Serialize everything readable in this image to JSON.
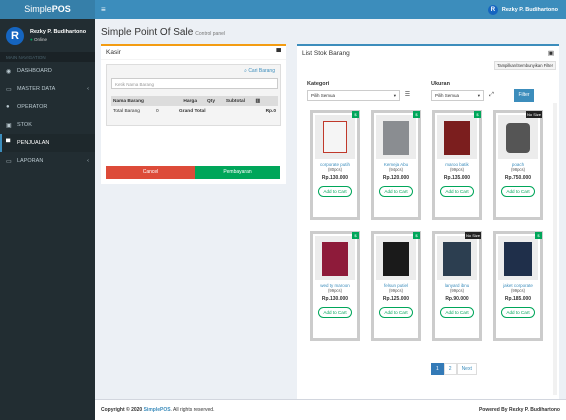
{
  "app": {
    "brand_light": "Simple",
    "brand_bold": "POS"
  },
  "topbar": {
    "menu_icon": "hamburger-icon",
    "user_name": "Rezky P. Budihartono",
    "user_initial": "R"
  },
  "sidebar": {
    "user_name": "Rezky P. Budihartono",
    "user_status": "Online",
    "user_initial": "R",
    "header": "MAIN NAVIGATION",
    "items": [
      {
        "label": "DASHBOARD",
        "icon": "dashboard-icon"
      },
      {
        "label": "MASTER DATA",
        "icon": "folder-icon",
        "chevron": "‹"
      },
      {
        "label": "OPERATOR",
        "icon": "user-icon"
      },
      {
        "label": "STOK",
        "icon": "cubes-icon"
      },
      {
        "label": "PENJUALAN",
        "icon": "cart-icon"
      },
      {
        "label": "LAPORAN",
        "icon": "folder-icon",
        "chevron": "‹"
      }
    ]
  },
  "page": {
    "title": "Simple Point Of Sale",
    "subtitle": "Control panel"
  },
  "kasir": {
    "title": "Kasir",
    "cari_link": "Cari Barang",
    "search_placeholder": "Ketik Nama Barang",
    "table_headers": [
      "Nama Barang",
      "Harga",
      "Qty",
      "Subtotal",
      ""
    ],
    "total_barang_label": "Total Barang",
    "total_barang_value": "0",
    "grand_total_label": "Grand Total",
    "grand_total_value": "Rp.0",
    "cancel_label": "Cancel",
    "pay_label": "Pembayaran"
  },
  "stok": {
    "title": "List Stok Barang",
    "filter_toggle_label": "Tampilkan/Sembunyikan Filter",
    "kategori_label": "Kategori",
    "kategori_value": "Pilih Semua",
    "ukuran_label": "Ukuran",
    "ukuran_value": "Pilih Semua",
    "filter_button": "Filter",
    "add_to_cart_label": "Add to Cart",
    "products": [
      {
        "name": "corporate putih",
        "stock": "(80pcs)",
        "price": "Rp.130.000",
        "badge": "$",
        "color": "#c0392b"
      },
      {
        "name": "Kemeja Abu",
        "stock": "(94pcs)",
        "price": "Rp.120.000",
        "badge": "$",
        "color": "#7f8c8d"
      },
      {
        "name": "maroo batik",
        "stock": "(99pcs)",
        "price": "Rp.135.000",
        "badge": "$",
        "color": "#7b1e1e"
      },
      {
        "name": "poach",
        "stock": "(98pcs)",
        "price": "Rp.750.000",
        "badge": "No Size",
        "color": "#555555"
      },
      {
        "name": "wed ty maroon",
        "stock": "(99pcs)",
        "price": "Rp.130.000",
        "badge": "$",
        "color": "#8e1b3a"
      },
      {
        "name": "felsun putiel",
        "stock": "(99pcs)",
        "price": "Rp.125.000",
        "badge": "$",
        "color": "#1a1a1a"
      },
      {
        "name": "lanyard ibnu",
        "stock": "(99pcs)",
        "price": "Rp.90.000",
        "badge": "No Size",
        "color": "#2c3e50"
      },
      {
        "name": "jaket corporate",
        "stock": "(99pcs)",
        "price": "Rp.185.000",
        "badge": "$",
        "color": "#1f2f4a"
      }
    ],
    "pager": [
      "1",
      "2",
      "Next"
    ]
  },
  "footer": {
    "copyright_prefix": "Copyright © 2020",
    "copyright_brand": "SimplePOS",
    "copyright_suffix": ". All rights reserved.",
    "powered_by": "Powered By Rezky P. Budihartono"
  },
  "colors": {
    "primary": "#3c8dbc",
    "success": "#00a65a",
    "danger": "#dd4b39",
    "warning": "#f39c12",
    "sidebar": "#222d32"
  }
}
